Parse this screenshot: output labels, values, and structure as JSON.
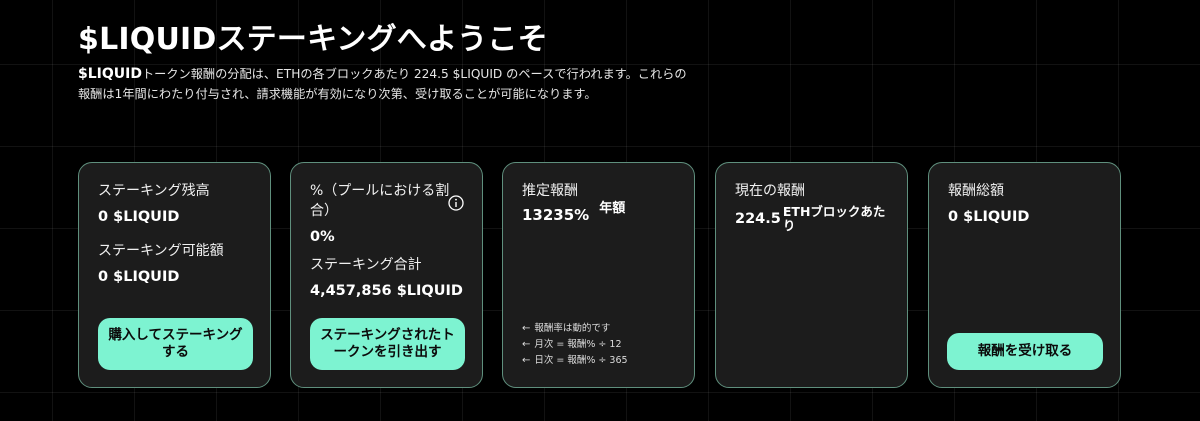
{
  "header": {
    "title": "$LIQUIDステーキングへようこそ",
    "intro_token": "$LIQUID",
    "intro_text": "トークン報酬の分配は、ETHの各ブロックあたり 224.5 $LIQUID のペースで行われます。これらの報酬は1年間にわたり付与され、請求機能が有効になり次第、受け取ることが可能になります。"
  },
  "cards": {
    "balance": {
      "staked_label": "ステーキング残高",
      "staked_value": "0 $LIQUID",
      "available_label": "ステーキング可能額",
      "available_value": "0 $LIQUID",
      "button": "購入してステーキングする"
    },
    "pool": {
      "share_label": "%（プールにおける割合）",
      "share_value": "0%",
      "total_label": "ステーキング合計",
      "total_value": "4,457,856 $LIQUID",
      "button": "ステーキングされたトークンを引き出す",
      "info_icon": "info-icon"
    },
    "estimated": {
      "label": "推定報酬",
      "value": "13235%",
      "unit": "年額",
      "notes": [
        "報酬率は動的です",
        "月次 = 報酬% ÷ 12",
        "日次 = 報酬% ÷ 365"
      ]
    },
    "current": {
      "label": "現在の報酬",
      "value": "224.5",
      "unit": "ETHブロックあたり"
    },
    "total": {
      "label": "報酬総額",
      "value": "0 $LIQUID",
      "button": "報酬を受け取る"
    }
  },
  "colors": {
    "accent": "#7df3d1",
    "card_bg": "#1c1c1c",
    "card_border": "#5f8f7d",
    "page_bg": "#000000"
  }
}
